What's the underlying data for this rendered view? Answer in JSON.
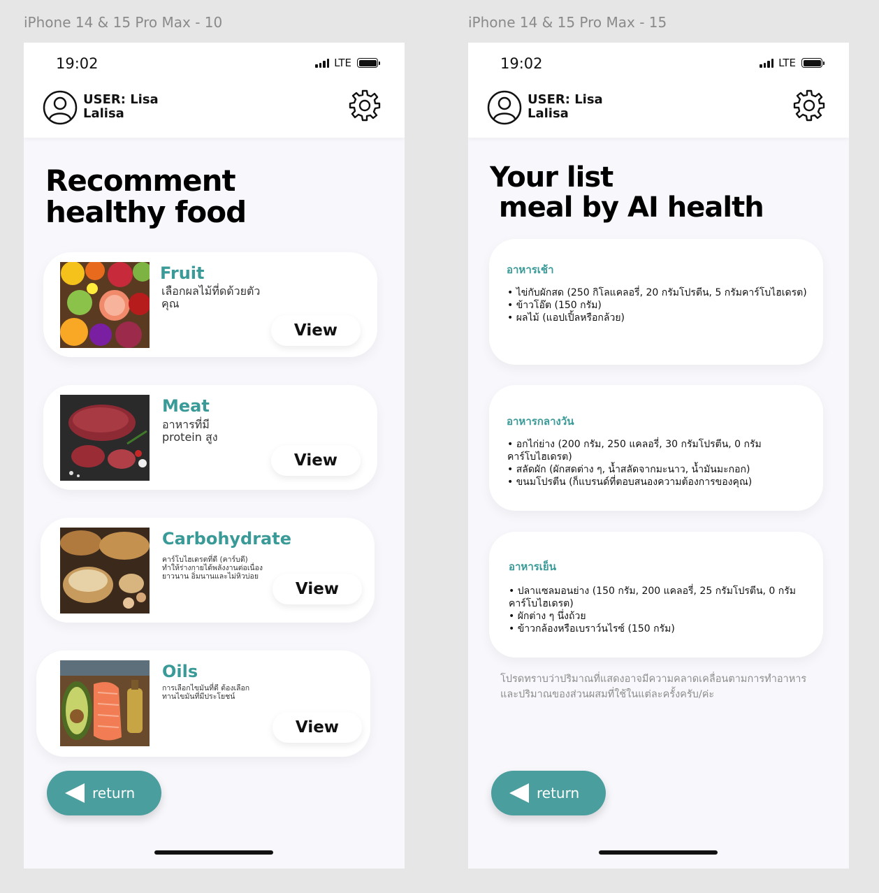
{
  "frames": {
    "left_title": "iPhone 14 & 15 Pro Max - 10",
    "right_title": "iPhone 14 & 15 Pro Max - 15"
  },
  "status": {
    "time": "19:02",
    "network": "LTE"
  },
  "user": {
    "label": "USER: Lisa Lalisa"
  },
  "screen_recommend": {
    "heading": "Recomment\nhealthy food",
    "cards": [
      {
        "title": "Fruit",
        "desc": "เลือกผลไม้ที่ดด้วยตัวคุณ",
        "button": "View"
      },
      {
        "title": "Meat",
        "desc": "อาหารที่มี\nprotein สูง",
        "button": "View"
      },
      {
        "title": "Carbohydrate",
        "desc": "คาร์โบไฮเดรตที่ดี (คาร์บดี) ทำให้ร่างกายได้พลังงานต่อเนื่องยาวนาน อิ่มนานและไม่หิวบ่อย",
        "button": "View"
      },
      {
        "title": "Oils",
        "desc": "การเลือกไขมันที่ดี ต้องเลือกทานไขมันที่มีประโยชน์",
        "button": "View"
      }
    ],
    "return": "return"
  },
  "screen_meal": {
    "heading": "Your list\n meal by AI health",
    "meals": [
      {
        "title": "อาหารเช้า",
        "items": [
          "ไข่กับผักสด (250 กิโลแคลอรี่, 20 กรัมโปรตีน, 5 กรัมคาร์โบไฮเดรต)",
          "ข้าวโอ๊ต (150 กรัม)",
          "ผลไม้ (แอปเปิ้ลหรือกล้วย)"
        ]
      },
      {
        "title": "อาหารกลางวัน",
        "items": [
          "อกไก่ย่าง (200 กรัม, 250 แคลอรี่, 30 กรัมโปรตีน, 0 กรัมคาร์โบไฮเดรต)",
          "สลัดผัก (ผักสดต่าง ๆ, น้ำสลัดจากมะนาว, น้ำมันมะกอก)",
          "ขนมโปรตีน (ก็แบรนด์ที่ตอบสนองความต้องการของคุณ)"
        ]
      },
      {
        "title": "อาหารเย็น",
        "items": [
          "ปลาแซลมอนย่าง (150 กรัม, 200 แคลอรี่, 25 กรัมโปรตีน, 0 กรัมคาร์โบไฮเดรต)",
          "ผักต่าง ๆ นึ่งถ้วย",
          "ข้าวกล้องหรือเบราว์นไรซ์ (150 กรัม)"
        ]
      }
    ],
    "note": "โปรดทราบว่าปริมาณที่แสดงอาจมีความคลาดเคลื่อนตามการทำอาหารและปริมาณของส่วนผสมที่ใช้ในแต่ละครั้งครับ/ค่ะ",
    "return": "return"
  },
  "colors": {
    "accent": "#3a9a98",
    "return_button": "#4a9e9e",
    "background": "#f8f8fc"
  },
  "icons": [
    "signal-icon",
    "battery-icon",
    "user-avatar-icon",
    "gear-icon",
    "back-arrow-icon"
  ]
}
